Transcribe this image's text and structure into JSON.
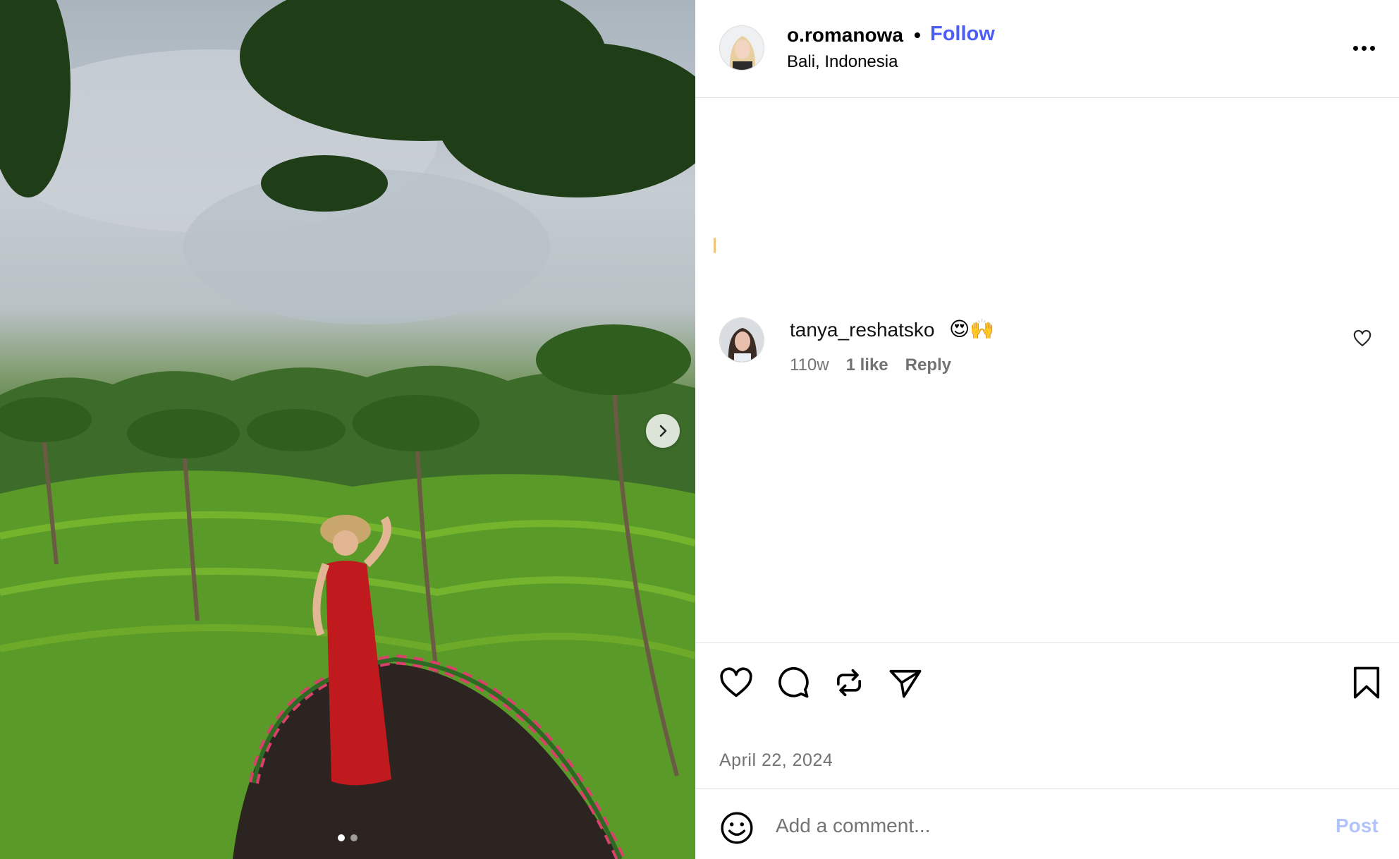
{
  "post": {
    "owner": {
      "username": "o.romanowa",
      "location": "Bali, Indonesia",
      "separator": "•",
      "follow_label": "Follow"
    },
    "carousel": {
      "total": 2,
      "current": 1
    },
    "date": "April 22, 2024"
  },
  "comments": [
    {
      "username": "tanya_reshatsko",
      "text": "😍🙌",
      "age": "110w",
      "likes": "1 like",
      "reply_label": "Reply"
    }
  ],
  "composer": {
    "placeholder": "Add a comment...",
    "post_label": "Post"
  },
  "colors": {
    "accent": "#4a5df9",
    "post_disabled": "#b3c4fb",
    "muted": "#737373",
    "divider": "#e3e3e3"
  },
  "icons": {
    "header": [
      "more-options-icon"
    ],
    "actions": [
      "heart-icon",
      "comment-icon",
      "repost-icon",
      "share-icon",
      "bookmark-icon"
    ],
    "composer": [
      "emoji-icon"
    ],
    "media": [
      "chevron-right-icon"
    ]
  }
}
